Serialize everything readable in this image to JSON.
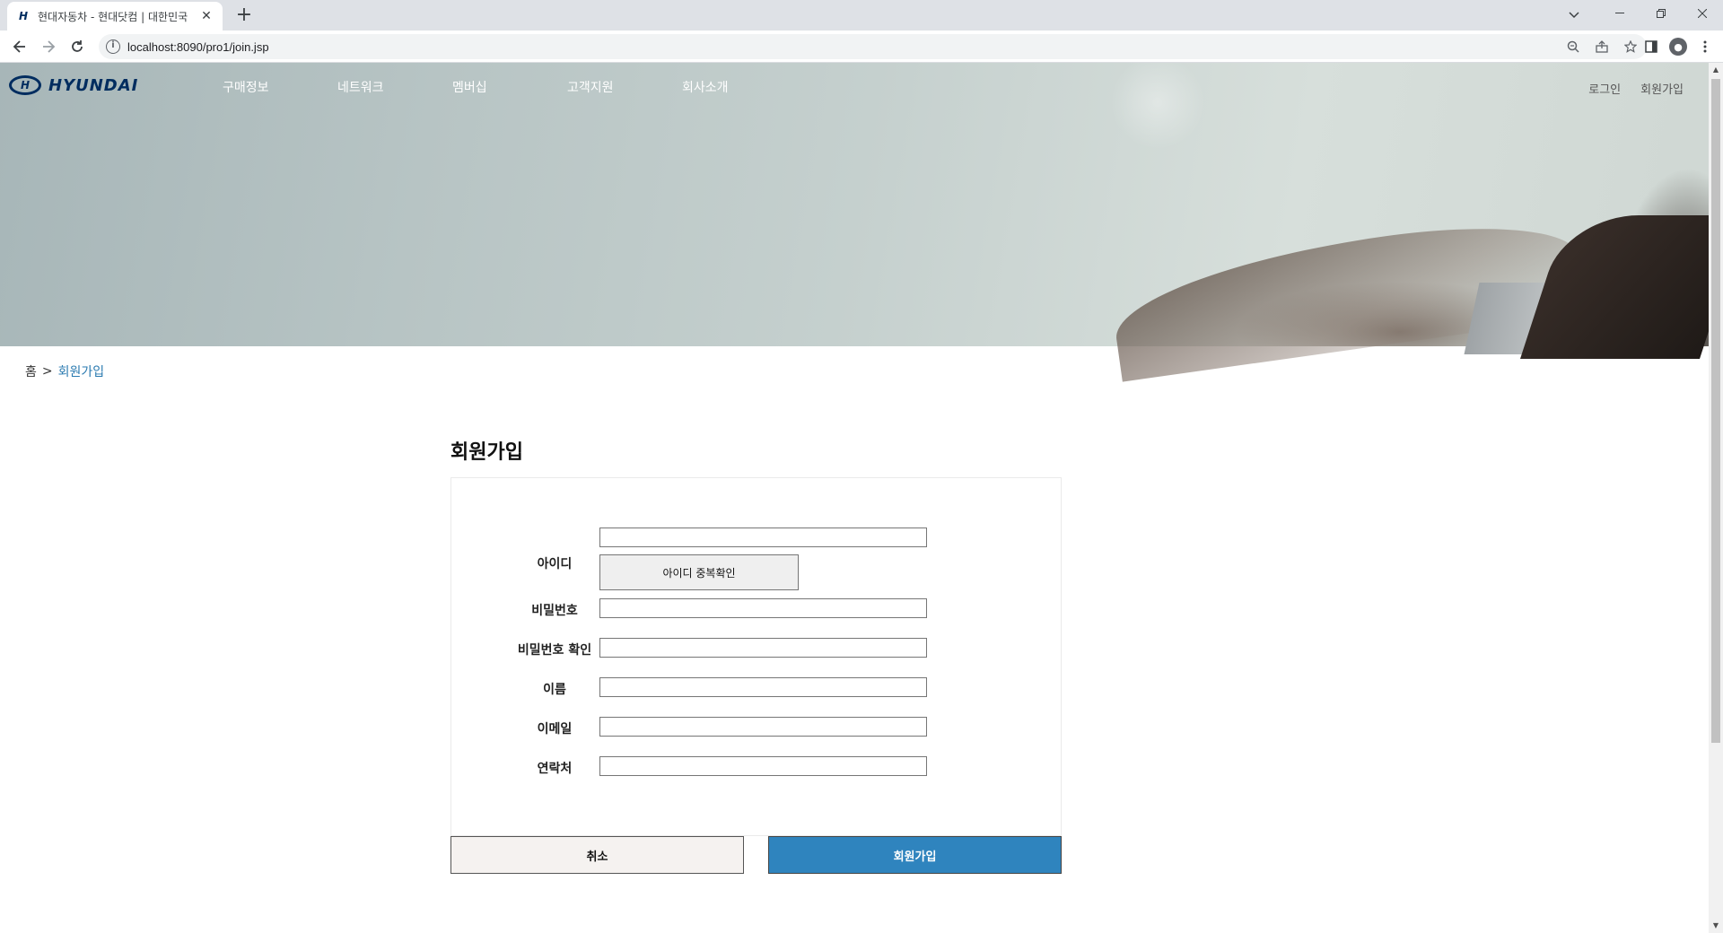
{
  "browser": {
    "tab_title": "현대자동차 - 현대닷컴 | 대한민국",
    "url": "localhost:8090/pro1/join.jsp",
    "tab_close": "✕",
    "new_tab": "+"
  },
  "header": {
    "logo_text": "HYUNDAI",
    "nav": [
      "구매정보",
      "네트워크",
      "멤버십",
      "고객지원",
      "회사소개"
    ],
    "util": {
      "login": "로그인",
      "join": "회원가입"
    }
  },
  "breadcrumb": {
    "home": "홈",
    "separator": ">",
    "current": "회원가입"
  },
  "form": {
    "title": "회원가입",
    "fields": {
      "id": {
        "label": "아이디",
        "value": ""
      },
      "password": {
        "label": "비밀번호",
        "value": ""
      },
      "password_confirm": {
        "label": "비밀번호 확인",
        "value": ""
      },
      "name": {
        "label": "이름",
        "value": ""
      },
      "email": {
        "label": "이메일",
        "value": ""
      },
      "phone": {
        "label": "연락처",
        "value": ""
      }
    },
    "dup_check_button": "아이디 중복확인",
    "cancel_button": "취소",
    "submit_button": "회원가입"
  },
  "colors": {
    "brand": "#002c5f",
    "accent": "#2f84be",
    "breadcrumb_current": "#2a7ab0"
  }
}
